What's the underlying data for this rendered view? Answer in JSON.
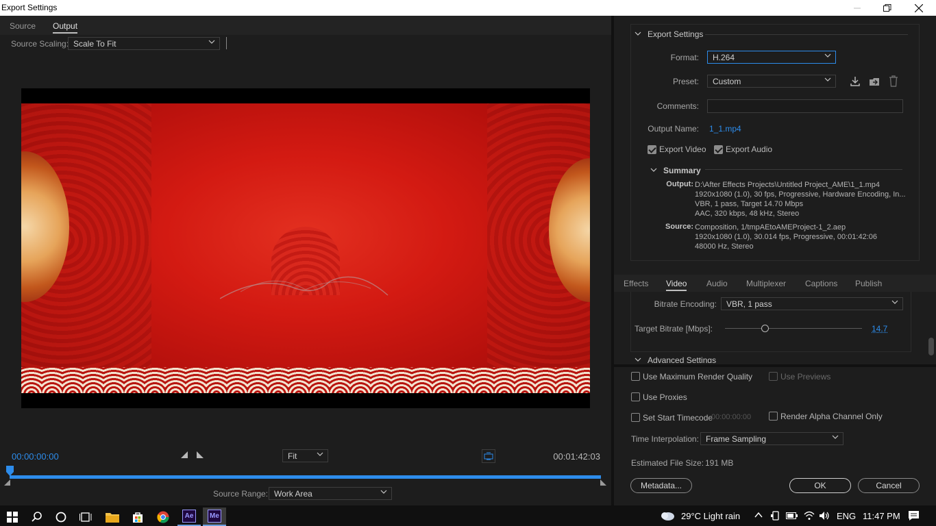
{
  "window": {
    "title": "Export Settings"
  },
  "left": {
    "tabs": [
      {
        "label": "Source"
      },
      {
        "label": "Output"
      }
    ],
    "source_scaling": {
      "label": "Source Scaling:",
      "value": "Scale To Fit"
    },
    "timecode_current": "00:00:00:00",
    "timecode_end": "00:01:42:03",
    "zoom": {
      "value": "Fit"
    },
    "source_range": {
      "label": "Source Range:",
      "value": "Work Area"
    }
  },
  "export_settings": {
    "heading": "Export Settings",
    "format": {
      "label": "Format:",
      "value": "H.264"
    },
    "preset": {
      "label": "Preset:",
      "value": "Custom"
    },
    "comments": {
      "label": "Comments:",
      "value": ""
    },
    "output_name": {
      "label": "Output Name:",
      "value": "1_1.mp4"
    },
    "export_video": {
      "label": "Export Video",
      "checked": true
    },
    "export_audio": {
      "label": "Export Audio",
      "checked": true
    },
    "summary": {
      "heading": "Summary",
      "output_label": "Output:",
      "output_lines": [
        "D:\\After Effects Projects\\Untitled Project_AME\\1_1.mp4",
        "1920x1080 (1.0), 30 fps, Progressive, Hardware Encoding, In...",
        "VBR, 1 pass, Target 14.70 Mbps",
        "AAC, 320 kbps, 48 kHz, Stereo"
      ],
      "source_label": "Source:",
      "source_lines": [
        "Composition, 1/tmpAEtoAMEProject-1_2.aep",
        "1920x1080 (1.0), 30.014 fps, Progressive, 00:01:42:06",
        "48000 Hz, Stereo"
      ]
    }
  },
  "settings_tabs": [
    {
      "label": "Effects"
    },
    {
      "label": "Video"
    },
    {
      "label": "Audio"
    },
    {
      "label": "Multiplexer"
    },
    {
      "label": "Captions"
    },
    {
      "label": "Publish"
    }
  ],
  "video": {
    "bitrate_encoding": {
      "label": "Bitrate Encoding:",
      "value": "VBR, 1 pass"
    },
    "target_bitrate": {
      "label": "Target Bitrate [Mbps]:",
      "value": "14.7",
      "fraction": 0.29
    },
    "advanced_settings": "Advanced Settings"
  },
  "bottom": {
    "max_render_quality": {
      "label": "Use Maximum Render Quality",
      "checked": false
    },
    "use_previews": {
      "label": "Use Previews",
      "checked": false
    },
    "use_proxies": {
      "label": "Use Proxies",
      "checked": false
    },
    "start_timecode": {
      "label": "Set Start Timecode",
      "value": "00:00:00:00",
      "checked": false
    },
    "alpha_only": {
      "label": "Render Alpha Channel Only",
      "checked": false
    },
    "time_interpolation": {
      "label": "Time Interpolation:",
      "value": "Frame Sampling"
    },
    "file_size": {
      "label": "Estimated File Size:",
      "value": "191 MB"
    },
    "metadata_button": "Metadata...",
    "ok_button": "OK",
    "cancel_button": "Cancel"
  },
  "taskbar": {
    "weather": "29°C  Light rain",
    "language": "ENG",
    "time": "11:47 PM",
    "ae_label": "Ae",
    "me_label": "Me"
  },
  "colors": {
    "accent_blue": "#2d8ceb",
    "panel_bg": "#1d1d1d"
  }
}
